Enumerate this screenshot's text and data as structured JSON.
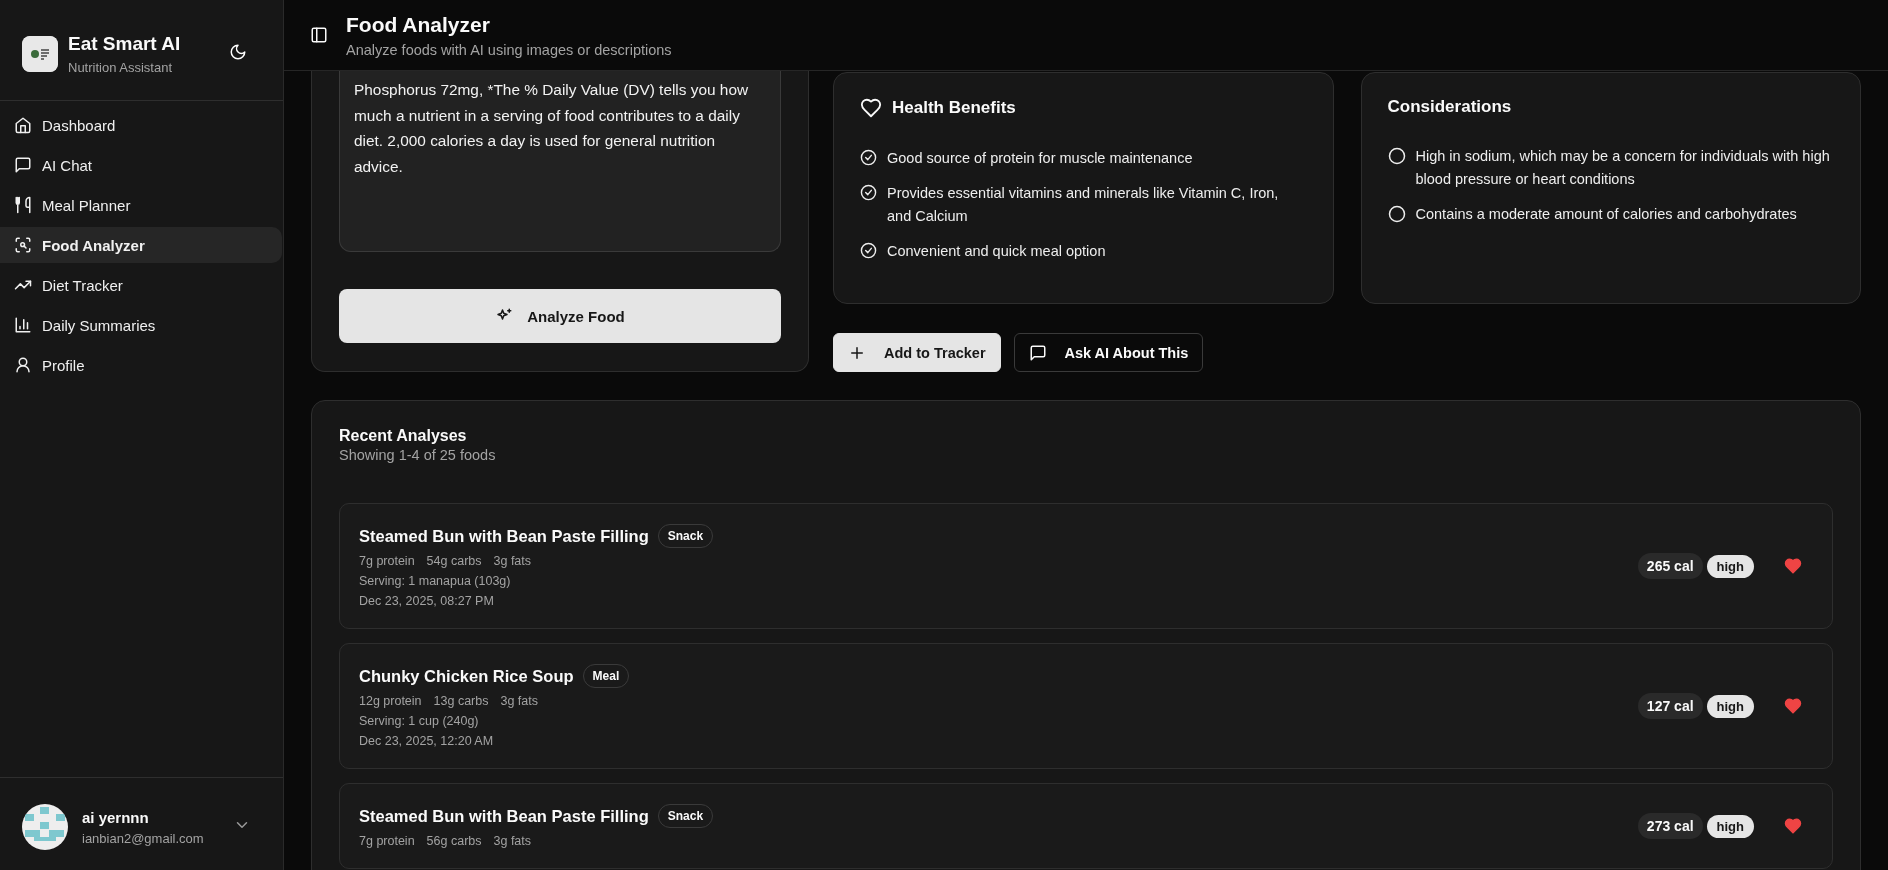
{
  "app": {
    "name": "Eat Smart AI",
    "subtitle": "Nutrition Assistant"
  },
  "nav": [
    {
      "label": "Dashboard",
      "selected": false
    },
    {
      "label": "AI Chat",
      "selected": false
    },
    {
      "label": "Meal Planner",
      "selected": false
    },
    {
      "label": "Food Analyzer",
      "selected": true
    },
    {
      "label": "Diet Tracker",
      "selected": false
    },
    {
      "label": "Daily Summaries",
      "selected": false
    },
    {
      "label": "Profile",
      "selected": false
    }
  ],
  "user": {
    "name": "ai yernnn",
    "email": "ianbian2@gmail.com"
  },
  "header": {
    "title": "Food Analyzer",
    "subtitle": "Analyze foods with AI using images or descriptions"
  },
  "description": {
    "value": "Phosphorus 72mg, *The % Daily Value (DV) tells you how much a nutrient in a serving of food contributes to a daily diet. 2,000 calories a day is used for general nutrition advice."
  },
  "analyze_button": "Analyze Food",
  "health_benefits": {
    "title": "Health Benefits",
    "items": [
      "Good source of protein for muscle maintenance",
      "Provides essential vitamins and minerals like Vitamin C, Iron, and Calcium",
      "Convenient and quick meal option"
    ]
  },
  "considerations": {
    "title": "Considerations",
    "items": [
      "High in sodium, which may be a concern for individuals with high blood pressure or heart conditions",
      "Contains a moderate amount of calories and carbohydrates"
    ]
  },
  "actions": [
    {
      "label": "Add to Tracker",
      "kind": "primary"
    },
    {
      "label": "Ask AI About This",
      "kind": "secondary"
    }
  ],
  "recent": {
    "title": "Recent Analyses",
    "subtitle": "Showing 1-4 of 25 foods",
    "items": [
      {
        "name": "Steamed Bun with Bean Paste Filling",
        "tag": "Snack",
        "macros": [
          "7g protein",
          "54g carbs",
          "3g fats"
        ],
        "serving": "Serving: 1 manapua (103g)",
        "date": "Dec 23, 2025, 08:27 PM",
        "calories": "265 cal",
        "rating": "high",
        "favorite": true
      },
      {
        "name": "Chunky Chicken Rice Soup",
        "tag": "Meal",
        "macros": [
          "12g protein",
          "13g carbs",
          "3g fats"
        ],
        "serving": "Serving: 1 cup (240g)",
        "date": "Dec 23, 2025, 12:20 AM",
        "calories": "127 cal",
        "rating": "high",
        "favorite": true
      },
      {
        "name": "Steamed Bun with Bean Paste Filling",
        "tag": "Snack",
        "macros": [
          "7g protein",
          "56g carbs",
          "3g fats"
        ],
        "calories": "273 cal",
        "rating": "high",
        "favorite": true
      }
    ]
  }
}
